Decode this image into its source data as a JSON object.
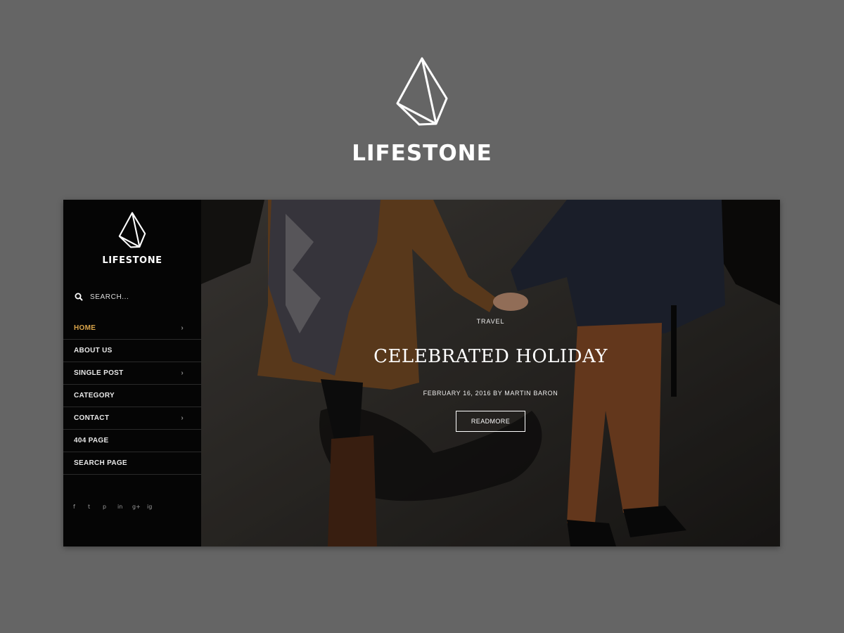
{
  "brand": {
    "name": "LIFESTONE",
    "logo_icon": "crystal-stone-icon"
  },
  "sidebar": {
    "brand_name": "LIFESTONE",
    "search": {
      "placeholder": "SEARCH...",
      "icon": "search-icon"
    },
    "nav_items": [
      {
        "label": "HOME",
        "active": true,
        "has_submenu": true
      },
      {
        "label": "ABOUT US",
        "active": false,
        "has_submenu": false
      },
      {
        "label": "SINGLE POST",
        "active": false,
        "has_submenu": true
      },
      {
        "label": "CATEGORY",
        "active": false,
        "has_submenu": false
      },
      {
        "label": "CONTACT",
        "active": false,
        "has_submenu": true
      },
      {
        "label": "404 PAGE",
        "active": false,
        "has_submenu": false
      },
      {
        "label": "SEARCH PAGE",
        "active": false,
        "has_submenu": false
      }
    ],
    "chevron": "›",
    "social": [
      {
        "name": "facebook-icon",
        "glyph": "f"
      },
      {
        "name": "twitter-icon",
        "glyph": "t"
      },
      {
        "name": "pinterest-icon",
        "glyph": "p"
      },
      {
        "name": "linkedin-icon",
        "glyph": "in"
      },
      {
        "name": "google-plus-icon",
        "glyph": "g+"
      },
      {
        "name": "instagram-icon",
        "glyph": "ig"
      }
    ]
  },
  "hero": {
    "category": "TRAVEL",
    "title": "CELEBRATED HOLIDAY",
    "meta": "FEBRUARY 16, 2016 BY MARTIN BARON",
    "button_label": "READMORE"
  },
  "colors": {
    "page_background": "#656565",
    "sidebar_background": "#050505",
    "accent": "#d9a44a",
    "text": "#ffffff"
  }
}
